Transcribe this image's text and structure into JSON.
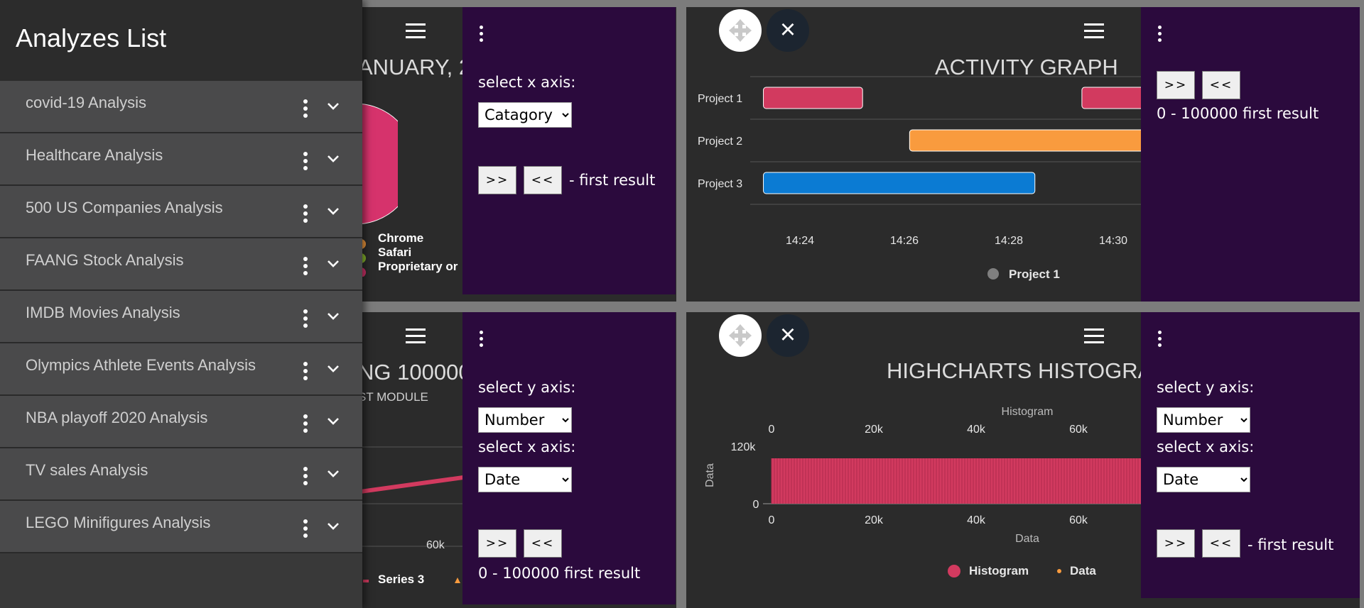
{
  "sidebar": {
    "title": "Analyzes List",
    "items": [
      {
        "label": "covid-19 Analysis"
      },
      {
        "label": "Healthcare Analysis"
      },
      {
        "label": "500 US Companies Analysis"
      },
      {
        "label": "FAANG Stock Analysis"
      },
      {
        "label": "IMDB Movies Analysis"
      },
      {
        "label": "Olympics Athlete Events Analysis"
      },
      {
        "label": "NBA playoff 2020 Analysis"
      },
      {
        "label": "TV sales Analysis"
      },
      {
        "label": "LEGO Minifigures Analysis"
      }
    ]
  },
  "panel_top_left": {
    "title": "ANUARY, 2",
    "legend": [
      "Chrome",
      "Safari",
      "Proprietary or"
    ],
    "legend_colors": [
      "#f19a3e",
      "#8ab92d",
      "#d6336c"
    ],
    "controls": {
      "x_label": "select x axis:",
      "x_value": "Catagory",
      "next": ">>",
      "prev": "<<",
      "result": "- first result"
    }
  },
  "panel_top_right": {
    "title": "ACTIVITY GRAPH",
    "controls": {
      "next": ">>",
      "prev": "<<",
      "result": "0 - 100000 first result"
    }
  },
  "panel_bottom_left": {
    "title": "NG 100000",
    "subtitle": "ST MODULE",
    "tick": "60k",
    "legend": "Series 3",
    "controls": {
      "y_label": "select y axis:",
      "y_value": "Number",
      "x_label": "select x axis:",
      "x_value": "Date",
      "next": ">>",
      "prev": "<<",
      "result": "0 - 100000 first result"
    }
  },
  "panel_bottom_right": {
    "title": "HIGHCHARTS HISTOGRA",
    "controls": {
      "y_label": "select y axis:",
      "y_value": "Number",
      "x_label": "select x axis:",
      "x_value": "Date",
      "next": ">>",
      "prev": "<<",
      "result": "- first result"
    }
  },
  "chart_data": [
    {
      "type": "bar",
      "title": "ACTIVITY GRAPH",
      "categories": [
        "Project 1",
        "Project 2",
        "Project 3"
      ],
      "x_ticks": [
        "14:24",
        "14:26",
        "14:28",
        "14:30"
      ],
      "series": [
        {
          "name": "Project 1",
          "category": "Project 1",
          "start": "14:23.3",
          "end": "14:25.2",
          "color": "#d23a5f"
        },
        {
          "name": "Project 1",
          "category": "Project 1",
          "start": "14:29.4",
          "end": "14:30.6",
          "color": "#d23a5f"
        },
        {
          "category": "Project 2",
          "start": "14:26.1",
          "end": "14:30.6",
          "color": "#f99b3e"
        },
        {
          "category": "Project 3",
          "start": "14:23.3",
          "end": "14:28.5",
          "color": "#0b7bd3"
        }
      ],
      "legend": [
        "Project 1"
      ]
    },
    {
      "type": "bar",
      "title": "HIGHCHARTS HISTOGRA",
      "subtitle": "Histogram",
      "xlabel": "Data",
      "ylabel": "Data",
      "x_ticks": [
        "0",
        "20k",
        "40k",
        "60k"
      ],
      "y_ticks": [
        "120k",
        "0"
      ],
      "ylim": [
        0,
        120000
      ],
      "series": [
        {
          "name": "Histogram",
          "color": "#d23a5f",
          "value": 120000
        },
        {
          "name": "Data",
          "color": "#f99b3e"
        }
      ],
      "legend": [
        "Histogram",
        "Data"
      ]
    }
  ]
}
